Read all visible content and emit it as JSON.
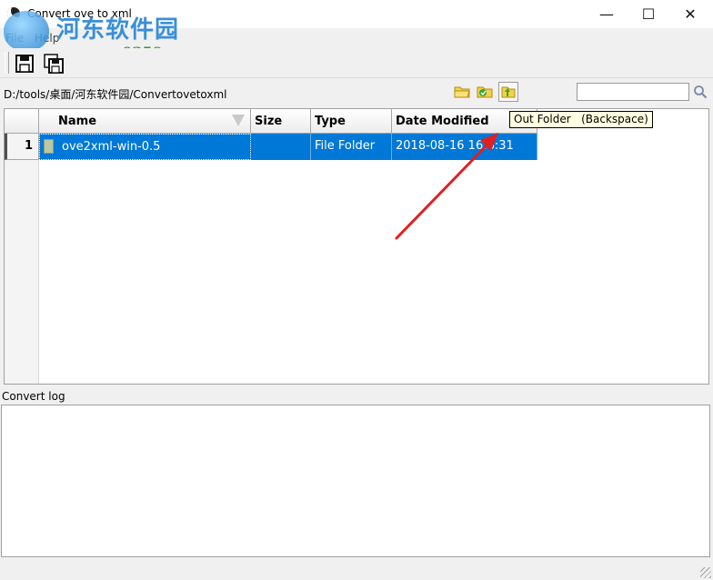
{
  "window": {
    "title": "Convert ove to xml",
    "minimize_glyph": "—",
    "maximize_glyph": "☐",
    "close_glyph": "✕"
  },
  "menu": {
    "items": [
      "File",
      "Help"
    ]
  },
  "watermark": {
    "name": "河东软件园",
    "url": "www.pc0359.cn"
  },
  "toolbar": {
    "icons": [
      "save-icon",
      "save-all-icon"
    ]
  },
  "pathbar": {
    "path": "D:/tools/桌面/河东软件园/Convertovetoxml",
    "search_value": "",
    "icons": [
      "folder-icon",
      "folder-favorite-icon",
      "folder-up-icon",
      "search-icon"
    ]
  },
  "filelist": {
    "columns": [
      "Name",
      "Size",
      "Type",
      "Date Modified"
    ],
    "rows": [
      {
        "num": "1",
        "name": "ove2xml-win-0.5",
        "size": "",
        "type": "File Folder",
        "date": "2018-08-16 16:6:31",
        "selected": true
      }
    ]
  },
  "tooltip": {
    "text": "Out Folder   (Backspace)"
  },
  "log": {
    "label": "Convert log",
    "content": ""
  },
  "colors": {
    "selection": "#0078d7",
    "tooltip_bg": "#ffffe1",
    "arrow": "#e02020"
  }
}
